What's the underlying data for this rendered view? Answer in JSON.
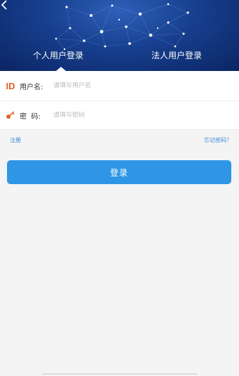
{
  "tabs": {
    "personal_label": "个人用户登录",
    "legal_label": "法人用户登录",
    "active": "personal"
  },
  "form": {
    "id_icon_text": "ID",
    "username_label": "用户名:",
    "username_placeholder": "请填写用户名",
    "password_label": "密  码:",
    "password_placeholder": "请填写密码"
  },
  "links": {
    "register": "注册",
    "forgot_password": "忘记密码？"
  },
  "login_button": "登录",
  "icons": [
    "back-arrow-icon",
    "id-icon",
    "key-icon"
  ],
  "colors": {
    "hero_bg": "#173f8e",
    "accent_blue": "#2f96e6",
    "link_blue": "#3a8ad6",
    "id_icon_orange": "#e0612b",
    "page_bg": "#f4f4f4"
  }
}
